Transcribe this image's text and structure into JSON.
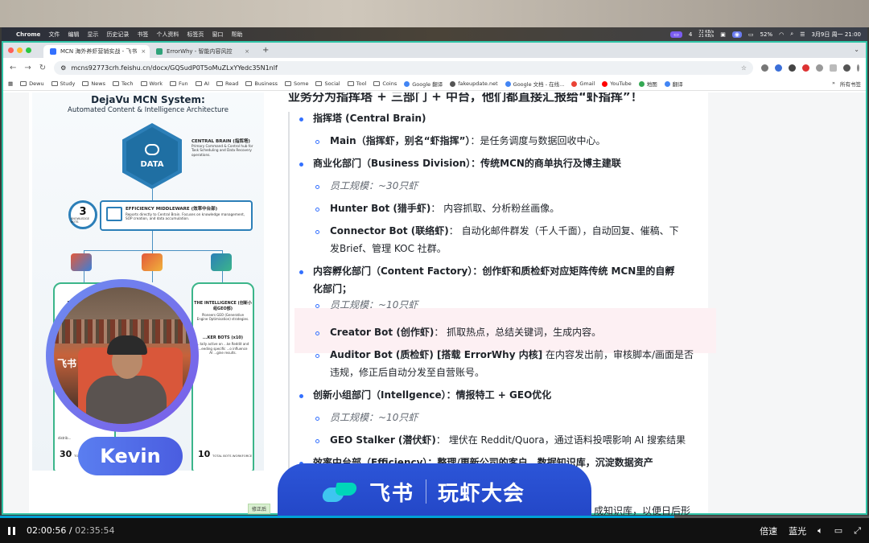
{
  "menubar": {
    "app": "Chrome",
    "items": [
      "文件",
      "编辑",
      "显示",
      "历史记录",
      "书签",
      "个人资料",
      "标签页",
      "窗口",
      "帮助"
    ],
    "tray": {
      "net_up": "72 KB/s",
      "net_down": "21 KB/s",
      "count": "4",
      "battery": "52%",
      "datetime": "3月9日 周一 21:00"
    }
  },
  "tabs": [
    {
      "title": "MCN 海外养虾营销实战 - 飞书",
      "active": true,
      "favicon_color": "#3370ff"
    },
    {
      "title": "ErrorWhy - 智能内容风控",
      "active": false,
      "favicon_color": "#2fa37a"
    }
  ],
  "address": {
    "url": "mcns92773crh.feishu.cn/docx/GQSudP0T5oMuZLxYYedc35N1nlf"
  },
  "bookmarks": [
    {
      "label": "Dewu",
      "type": "folder"
    },
    {
      "label": "Study",
      "type": "folder"
    },
    {
      "label": "News",
      "type": "folder"
    },
    {
      "label": "Tech",
      "type": "folder"
    },
    {
      "label": "Work",
      "type": "folder"
    },
    {
      "label": "Fun",
      "type": "folder"
    },
    {
      "label": "AI",
      "type": "folder"
    },
    {
      "label": "Read",
      "type": "folder"
    },
    {
      "label": "Business",
      "type": "folder"
    },
    {
      "label": "Some",
      "type": "folder"
    },
    {
      "label": "Social",
      "type": "folder"
    },
    {
      "label": "Tool",
      "type": "folder"
    },
    {
      "label": "Coins",
      "type": "folder"
    },
    {
      "label": "Google 翻译",
      "type": "site",
      "color": "#4285f4"
    },
    {
      "label": "fakeupdate.net",
      "type": "site",
      "color": "#555555"
    },
    {
      "label": "Google 文档 - 在线...",
      "type": "site",
      "color": "#4285f4"
    },
    {
      "label": "Gmail",
      "type": "site",
      "color": "#ea4335"
    },
    {
      "label": "YouTube",
      "type": "site",
      "color": "#ff0000"
    },
    {
      "label": "地图",
      "type": "site",
      "color": "#34a853"
    },
    {
      "label": "翻译",
      "type": "site",
      "color": "#4285f4"
    }
  ],
  "bookmarks_right": {
    "more": "»",
    "all": "所有书签"
  },
  "infographic": {
    "title": "DejaVu MCN System:",
    "subtitle": "Automated Content & Intelligence Architecture",
    "core_label": "DATA",
    "central_title": "CENTRAL BRAIN (指挥塔)",
    "central_desc": "Primary Command & Control hub for Task Scheduling and Data Recovery operations.",
    "badge_num": "3",
    "badge_label": "KNOWLEDGE BOTS",
    "mw_title": "EFFICIENCY MIDDLEWARE (效率中台部)",
    "mw_desc": "Reports directly to Central Brain. Focuses on knowledge management, SOP creation, and data accumulation.",
    "card_left_title": "BUSINESS (商...",
    "card_left_desc": "Manag... for...",
    "card_left_num": "30",
    "card_left_numlabel": "TOTAL BOTS",
    "card_right_title": "THE INTELLIGENCE (创新小组GEO部)",
    "card_right_desc": "Pioneers GEO (Generative Engine Optimisation) strategies.",
    "card_right_sub": "...KER BOTS (x10)",
    "card_right_sub_desc": "...tally active on ...ke Reddit and ...eeding specific ...o influence AI ...gine results.",
    "card_right_num": "10",
    "card_right_numlabel": "TOTAL BOTS WORKFORCE",
    "card_left_bottom": "distrib..."
  },
  "doc": {
    "heading": "业务分为指挥塔 + 三部门 + 中台，他们都直接汇报给“虾指挥”！",
    "items": [
      {
        "level": 1,
        "text": "指挥塔 (Central Brain)"
      },
      {
        "level": 2,
        "bold": "Main（指挥虾，别名“虾指挥”）",
        "rest": "：是任务调度与数据回收中心。"
      },
      {
        "level": 1,
        "text": "商业化部门（Business Division）：传统MCN的商单执行及博主建联"
      },
      {
        "level": 2,
        "italic": "员工规模：~30只虾"
      },
      {
        "level": 2,
        "bold": "Hunter Bot (猎手虾)",
        "rest": "：  内容抓取、分析粉丝画像。"
      },
      {
        "level": 2,
        "bold": "Connector Bot (联络虾)",
        "rest": "：  自动化邮件群发（千人千面），自动回复、催稿、下",
        "cont": "发Brief、管理 KOC 社群。"
      },
      {
        "level": 1,
        "text": "内容孵化部门（Content Factory）：创作虾和质检虾对应矩阵传统 MCN里的自孵",
        "cont": "化部门；"
      },
      {
        "level": 2,
        "italic": "员工规模：~10只虾"
      },
      {
        "level": 2,
        "bold": "Creator Bot (创作虾)",
        "rest": "：  抓取热点，总结关键词，生成内容。"
      },
      {
        "level": 2,
        "bold": "Auditor Bot (质检虾)  [搭载 ErrorWhy 内核]",
        "rest": " 在内容发出前，审核脚本/画面是否",
        "cont": "违规，修正后自动分发至自营账号。"
      },
      {
        "level": 1,
        "text": "创新小组部门（Intellgence）：情报特工 + GEO优化"
      },
      {
        "level": 2,
        "italic": "员工规模：~10只虾"
      },
      {
        "level": 2,
        "bold": "GEO Stalker (潜伏虾)",
        "rest": "：  埋伏在 Reddit/Quora，通过语料投喂影响 AI 搜索结果"
      },
      {
        "level": 1,
        "text": "效率中台部（Efficiency）：整理/更新公司的客户、数据知识库，沉淀数据资产"
      }
    ],
    "tail": "成知识库，以便日后形",
    "chip": "修正后"
  },
  "overlay": {
    "presenter_name": "Kevin",
    "cam_watermark": "飞书"
  },
  "banner": {
    "brand": "飞书",
    "event": "玩虾大会"
  },
  "player": {
    "current": "02:00:56",
    "duration": "02:35:54",
    "progress": 0.776,
    "speed_label": "倍速",
    "quality_label": "蓝光"
  }
}
